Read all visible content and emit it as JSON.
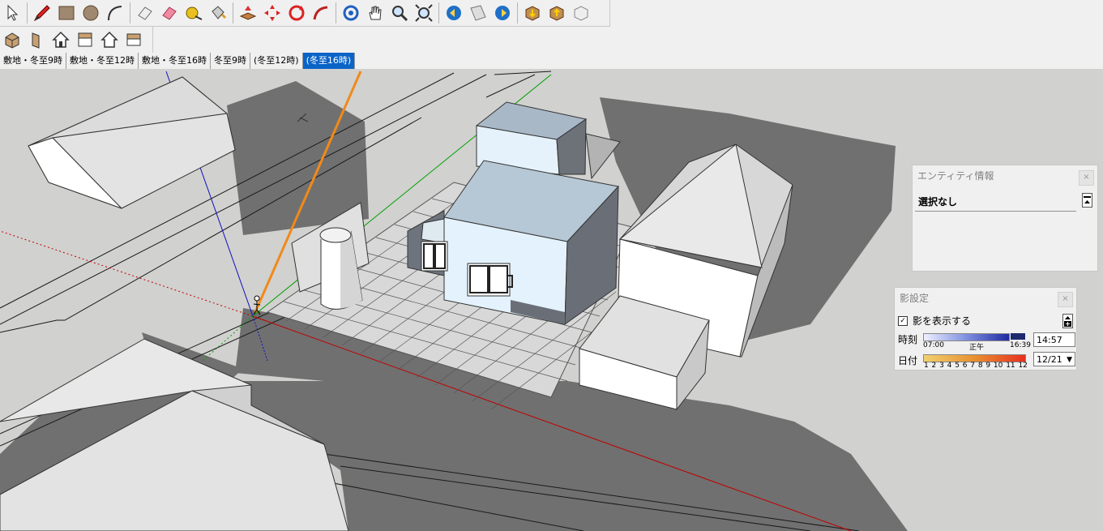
{
  "toolbar_main": {
    "icons": [
      "select-icon",
      "pencil-icon",
      "rectangle-icon",
      "circle-icon",
      "arc-icon",
      "eraser-outline-icon",
      "eraser-icon",
      "tape-measure-icon",
      "paint-bucket-icon",
      "push-pull-icon",
      "move-icon",
      "rotate-icon",
      "follow-me-icon",
      "orbit-icon",
      "pan-hand-icon",
      "zoom-icon",
      "zoom-extents-icon",
      "previous-view-icon",
      "section-plane-icon",
      "next-view-icon",
      "get-models-icon",
      "share-model-icon",
      "component-icon"
    ]
  },
  "toolbar_views": {
    "icons": [
      "iso-view-icon",
      "front-view-icon",
      "top-house-icon",
      "right-view-icon",
      "back-view-icon",
      "left-view-icon"
    ]
  },
  "scene_tabs": [
    {
      "label": "敷地・冬至9時",
      "active": false
    },
    {
      "label": "敷地・冬至12時",
      "active": false
    },
    {
      "label": "敷地・冬至16時",
      "active": false
    },
    {
      "label": "冬至9時",
      "active": false
    },
    {
      "label": "(冬至12時)",
      "active": false
    },
    {
      "label": "(冬至16時)",
      "active": true
    }
  ],
  "entity_info": {
    "title": "エンティティ情報",
    "selection": "選択なし",
    "close": "×"
  },
  "shadow_settings": {
    "title": "影設定",
    "close": "×",
    "show_shadows_label": "影を表示する",
    "show_shadows_checked": true,
    "time_label": "時刻",
    "time_start": "07:00",
    "time_noon": "正午",
    "time_end": "16:39",
    "time_value": "14:57",
    "date_label": "日付",
    "months": [
      "1",
      "2",
      "3",
      "4",
      "5",
      "6",
      "7",
      "8",
      "9",
      "10",
      "11",
      "12"
    ],
    "date_value": "12/21"
  },
  "colors": {
    "viewport_bg": "#d1d1cf",
    "shadow": "#6f6f6f",
    "axis_red": "#c00000",
    "axis_green": "#00a000",
    "axis_blue": "#0000c0",
    "sun_line": "#f08a1a",
    "active_tab": "#0a64c8"
  }
}
